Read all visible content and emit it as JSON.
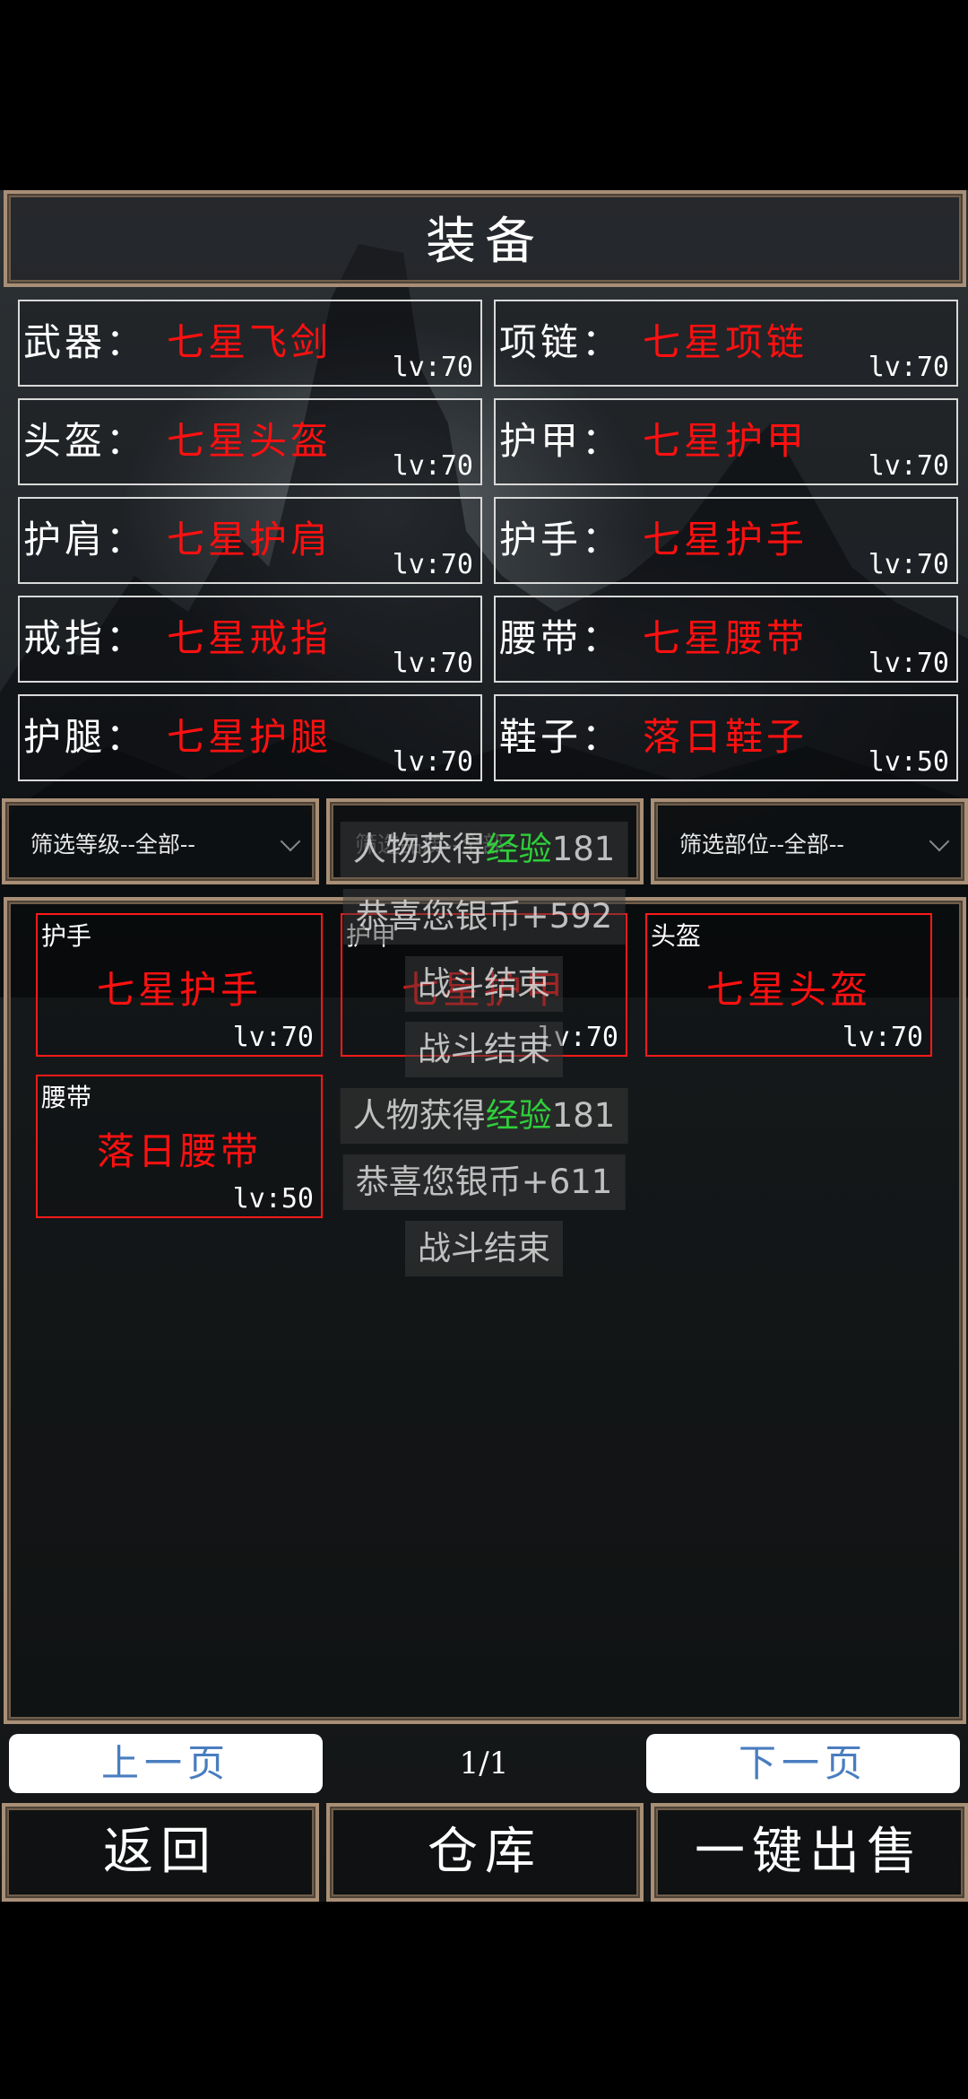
{
  "title": "装备",
  "equipped": [
    {
      "slot": "武器：",
      "name": "七星飞剑",
      "level": "lv:70"
    },
    {
      "slot": "项链：",
      "name": "七星项链",
      "level": "lv:70"
    },
    {
      "slot": "头盔：",
      "name": "七星头盔",
      "level": "lv:70"
    },
    {
      "slot": "护甲：",
      "name": "七星护甲",
      "level": "lv:70"
    },
    {
      "slot": "护肩：",
      "name": "七星护肩",
      "level": "lv:70"
    },
    {
      "slot": "护手：",
      "name": "七星护手",
      "level": "lv:70"
    },
    {
      "slot": "戒指：",
      "name": "七星戒指",
      "level": "lv:70"
    },
    {
      "slot": "腰带：",
      "name": "七星腰带",
      "level": "lv:70"
    },
    {
      "slot": "护腿：",
      "name": "七星护腿",
      "level": "lv:70"
    },
    {
      "slot": "鞋子：",
      "name": "落日鞋子",
      "level": "lv:50"
    }
  ],
  "filters": {
    "level": "筛选等级--全部--",
    "middle": "筛选品质--全部--",
    "part": "筛选部位--全部--"
  },
  "inventory": [
    {
      "type": "护手",
      "name": "七星护手",
      "level": "lv:70"
    },
    {
      "type": "护甲",
      "name": "七星护甲",
      "level": "lv:70"
    },
    {
      "type": "头盔",
      "name": "七星头盔",
      "level": "lv:70"
    },
    {
      "type": "腰带",
      "name": "落日腰带",
      "level": "lv:50"
    }
  ],
  "toasts": {
    "t1_pre": "人物获得",
    "t1_green": "经验",
    "t1_post": "181",
    "t2": "恭喜您银币+592",
    "t3": "战斗结束",
    "t4": "战斗结束",
    "t5_pre": "人物获得",
    "t5_green": "经验",
    "t5_post": "181",
    "t6": "恭喜您银币+611",
    "t7": "战斗结束"
  },
  "pager": {
    "prev": "上一页",
    "page": "1/1",
    "next": "下一页"
  },
  "actions": {
    "back": "返回",
    "warehouse": "仓库",
    "sell_all": "一键出售"
  },
  "colors": {
    "item_name": "#ff1010",
    "frame": "#a88f76",
    "pager_text": "#4a7dc0",
    "exp_green": "#2fcf3a"
  }
}
